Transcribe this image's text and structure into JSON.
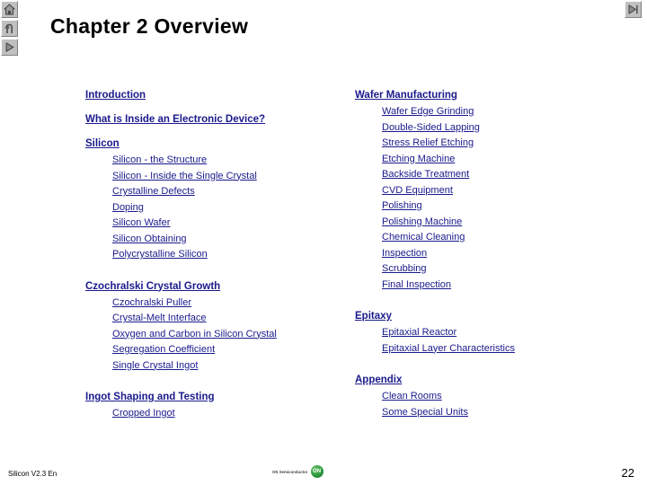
{
  "slide": {
    "title": "Chapter 2 Overview",
    "page_number": "22",
    "footer_label": "Silicon V2.3 En",
    "link_color": "#1a1a8c",
    "title_color": "#000000",
    "background": "#ffffff"
  },
  "nav": {
    "home": "home-button",
    "back": "return-button",
    "next": "play-button",
    "end": "skip-to-end-button"
  },
  "logo": {
    "text": "ON Semiconductor",
    "mark": "ON"
  },
  "left_column": [
    {
      "heading": "Introduction",
      "items": []
    },
    {
      "heading": "What is Inside an Electronic Device?",
      "items": []
    },
    {
      "heading": "Silicon",
      "items": [
        {
          "label": "Silicon - the Structure",
          "lead_underlined": true
        },
        {
          "label": "Silicon - Inside the Single Crystal",
          "lead_underlined": true
        },
        {
          "label": "Crystalline Defects",
          "lead_underlined": true
        },
        {
          "label": "Doping",
          "lead_underlined": true
        },
        {
          "label": "Silicon Wafer",
          "lead_underlined": true
        },
        {
          "label": "Silicon Obtaining",
          "lead_underlined": true
        },
        {
          "label": "Polycrystalline Silicon",
          "lead_underlined": true
        }
      ]
    },
    {
      "heading": "Czochralski Crystal Growth",
      "items": [
        {
          "label": "Czochralski Puller",
          "lead_underlined": false
        },
        {
          "label": "Crystal-Melt Interface",
          "lead_underlined": false
        },
        {
          "label": "Oxygen and Carbon in Silicon Crystal",
          "lead_underlined": false
        },
        {
          "label": "Segregation Coefficient",
          "lead_underlined": false
        },
        {
          "label": "Single Crystal Ingot",
          "lead_underlined": false
        }
      ]
    },
    {
      "heading": "Ingot Shaping and Testing",
      "items": [
        {
          "label": "Cropped Ingot",
          "lead_underlined": true
        }
      ]
    }
  ],
  "right_column": [
    {
      "heading": "Wafer Manufacturing",
      "items": [
        {
          "label": "Wafer Edge Grinding",
          "lead_underlined": true
        },
        {
          "label": "Double-Sided Lapping",
          "lead_underlined": true
        },
        {
          "label": "Stress Relief Etching",
          "lead_underlined": true
        },
        {
          "label": "Etching Machine",
          "lead_underlined": true
        },
        {
          "label": "Backside Treatment",
          "lead_underlined": true
        },
        {
          "label": "CVD Equipment",
          "lead_underlined": true
        },
        {
          "label": "Polishing",
          "lead_underlined": true
        },
        {
          "label": "Polishing Machine",
          "lead_underlined": true
        },
        {
          "label": "Chemical Cleaning",
          "lead_underlined": true
        },
        {
          "label": "Inspection",
          "lead_underlined": true
        },
        {
          "label": "Scrubbing",
          "lead_underlined": true
        },
        {
          "label": "Final Inspection",
          "lead_underlined": true
        }
      ]
    },
    {
      "heading": "Epitaxy",
      "items": [
        {
          "label": "Epitaxial Reactor",
          "lead_underlined": true
        },
        {
          "label": "Epitaxial Layer Characteristics",
          "lead_underlined": true
        }
      ]
    },
    {
      "heading": "Appendix",
      "items": [
        {
          "label": "Clean Rooms",
          "lead_underlined": false
        },
        {
          "label": "Some Special Units",
          "lead_underlined": true
        }
      ]
    }
  ]
}
